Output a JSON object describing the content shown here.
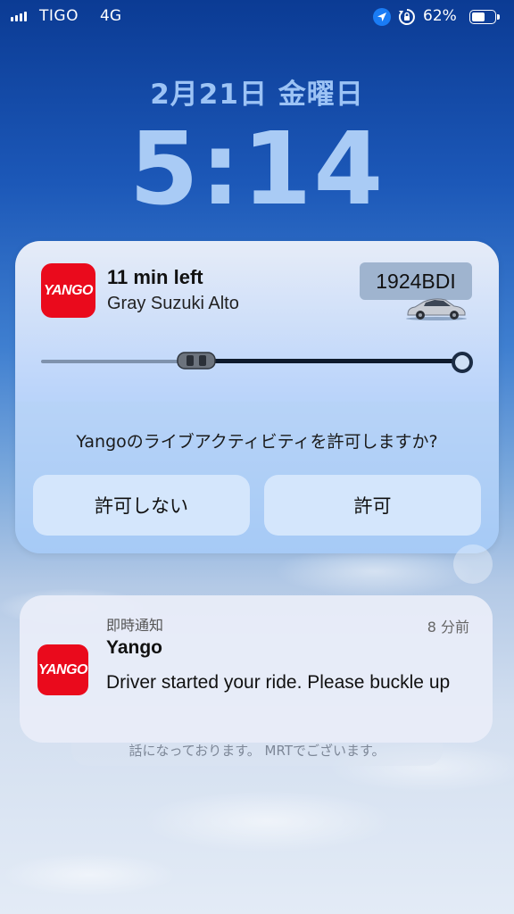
{
  "status_bar": {
    "carrier": "TIGO",
    "network": "4G",
    "battery_percent": "62%",
    "battery_level": 0.62
  },
  "lock_screen": {
    "date": "2月21日 金曜日",
    "time": "5:14"
  },
  "live_activity": {
    "app_logo": "YANGO",
    "title": "11 min left",
    "subtitle": "Gray Suzuki Alto",
    "plate": "1924BDI",
    "progress": 0.37,
    "prompt": "Yangoのライブアクティビティを許可しますか?",
    "deny_label": "許可しない",
    "allow_label": "許可"
  },
  "notification": {
    "app_logo": "YANGO",
    "category": "即時通知",
    "time_ago": "8 分前",
    "title": "Yango",
    "body": "Driver started your ride. Please buckle up"
  },
  "stacked_notification": {
    "text": "話になっております。 MRTでございます。"
  },
  "colors": {
    "yango_red": "#ea0a1c",
    "location_blue": "#1a7cf5"
  }
}
